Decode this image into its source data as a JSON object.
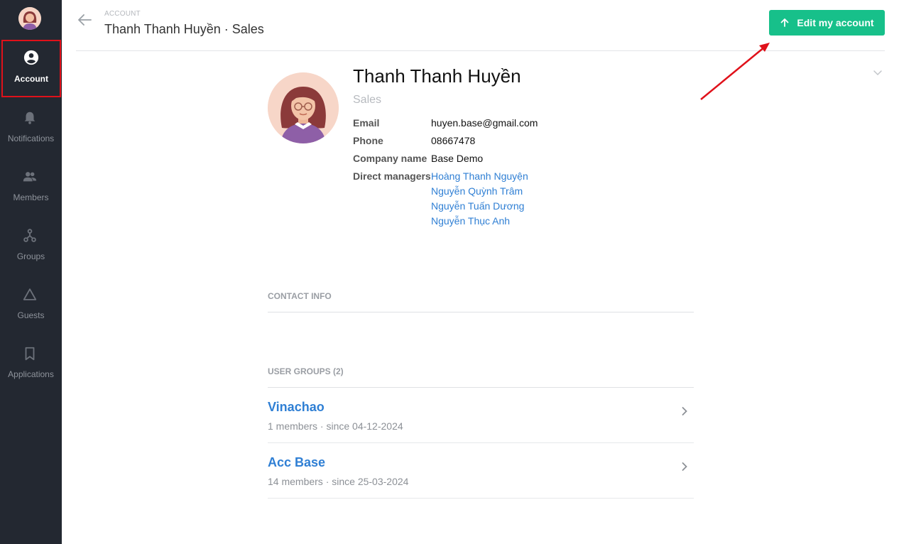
{
  "sidebar": {
    "items": [
      {
        "label": "Account",
        "icon": "account-circle-icon",
        "active": true
      },
      {
        "label": "Notifications",
        "icon": "bell-icon"
      },
      {
        "label": "Members",
        "icon": "members-icon"
      },
      {
        "label": "Groups",
        "icon": "groups-icon"
      },
      {
        "label": "Guests",
        "icon": "triangle-icon"
      },
      {
        "label": "Applications",
        "icon": "bookmark-icon"
      }
    ]
  },
  "header": {
    "breadcrumb": "ACCOUNT",
    "title": "Thanh Thanh Huyền · Sales",
    "edit_button": "Edit my account"
  },
  "profile": {
    "name": "Thanh Thanh Huyền",
    "role": "Sales",
    "email_label": "Email",
    "email": "huyen.base@gmail.com",
    "phone_label": "Phone",
    "phone": "08667478",
    "company_label": "Company name",
    "company": "Base Demo",
    "managers_label": "Direct managers",
    "managers": [
      "Hoàng Thanh Nguyện",
      "Nguyễn Quỳnh Trâm",
      "Nguyễn Tuấn Dương",
      "Nguyễn Thục Anh"
    ]
  },
  "contact_info": {
    "title": "CONTACT INFO"
  },
  "user_groups": {
    "title": "USER GROUPS (2)",
    "groups": [
      {
        "name": "Vinachao",
        "meta": "1 members · since 04-12-2024"
      },
      {
        "name": "Acc Base",
        "meta": "14 members · since 25-03-2024"
      }
    ]
  },
  "colors": {
    "sidebar_bg": "#232831",
    "accent": "#17c08a",
    "link": "#2f7fd4",
    "highlight_border": "#e0111a",
    "annotation_arrow": "#e0111a"
  }
}
